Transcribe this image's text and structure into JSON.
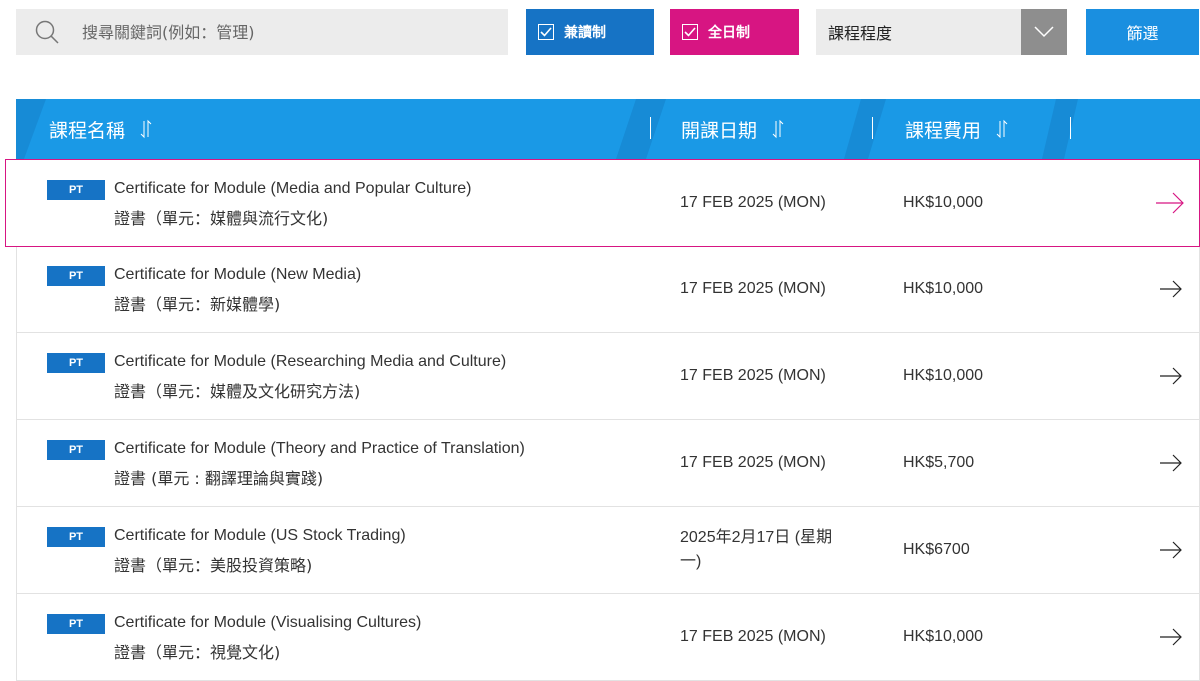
{
  "search": {
    "placeholder": "搜尋關鍵詞(例如：管理)",
    "value": ""
  },
  "filters": {
    "part_time": {
      "label": "兼讀制",
      "checked": true,
      "color": "#1673c5"
    },
    "full_time": {
      "label": "全日制",
      "checked": true,
      "color": "#d71582"
    },
    "level": {
      "selected": "課程程度"
    },
    "submit_label": "篩選"
  },
  "table": {
    "columns": [
      {
        "label": "課程名稱"
      },
      {
        "label": "開課日期"
      },
      {
        "label": "課程費用"
      }
    ],
    "rows": [
      {
        "badge": "PT",
        "title_en": "Certificate for Module (Media and Popular Culture)",
        "title_zh": "證書（單元：媒體與流行文化)",
        "date": "17 FEB 2025 (MON)",
        "fee": "HK$10,000",
        "highlighted": true
      },
      {
        "badge": "PT",
        "title_en": "Certificate for Module (New Media)",
        "title_zh": "證書（單元：新媒體學)",
        "date": "17 FEB 2025 (MON)",
        "fee": "HK$10,000",
        "highlighted": false
      },
      {
        "badge": "PT",
        "title_en": "Certificate for Module (Researching Media and Culture)",
        "title_zh": "證書（單元：媒體及文化研究方法)",
        "date": "17 FEB 2025 (MON)",
        "fee": "HK$10,000",
        "highlighted": false
      },
      {
        "badge": "PT",
        "title_en": "Certificate for Module (Theory and Practice of Translation)",
        "title_zh": "證書 (單元 : 翻譯理論與實踐)",
        "date": "17 FEB 2025 (MON)",
        "fee": "HK$5,700",
        "highlighted": false
      },
      {
        "badge": "PT",
        "title_en": "Certificate for Module (US Stock Trading)",
        "title_zh": "證書（單元：美股投資策略)",
        "date": "2025年2月17日 (星期一)",
        "fee": "HK$6700",
        "highlighted": false
      },
      {
        "badge": "PT",
        "title_en": "Certificate for Module (Visualising Cultures)",
        "title_zh": "證書（單元：視覺文化)",
        "date": "17 FEB 2025 (MON)",
        "fee": "HK$10,000",
        "highlighted": false
      }
    ]
  },
  "colors": {
    "header_blue": "#1a99e6",
    "accent_pink": "#d71582",
    "badge_blue": "#1673c5"
  }
}
